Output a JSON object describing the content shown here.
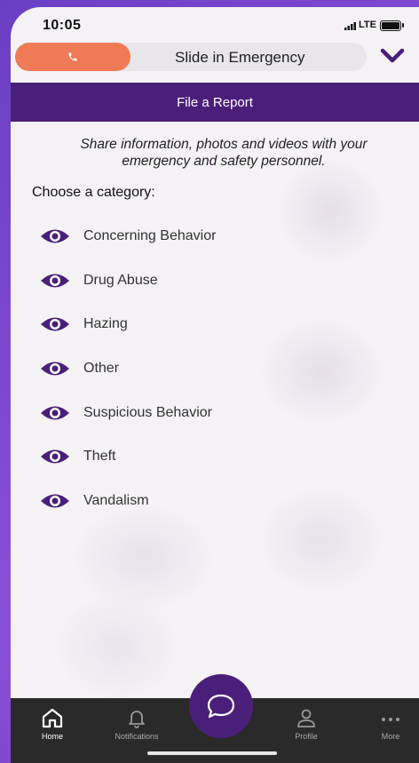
{
  "status": {
    "time": "10:05",
    "network": "LTE"
  },
  "emergency": {
    "label": "Slide in Emergency"
  },
  "header": {
    "title": "File a Report"
  },
  "intro": "Share information, photos and videos with your emergency and safety personnel.",
  "choose_label": "Choose a category:",
  "categories": [
    "Concerning Behavior",
    "Drug Abuse",
    "Hazing",
    "Other",
    "Suspicious Behavior",
    "Theft",
    "Vandalism"
  ],
  "tabs": {
    "home": "Home",
    "notifications": "Notifications",
    "profile": "Profile",
    "more": "More"
  },
  "colors": {
    "brand_purple": "#4a1f7a",
    "emergency_orange": "#ef7a55",
    "tabbar_bg": "#2a2a2a"
  }
}
